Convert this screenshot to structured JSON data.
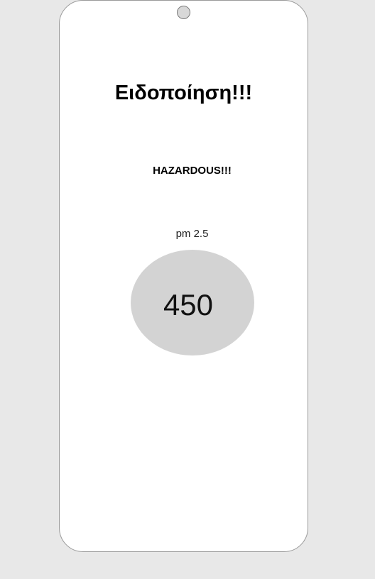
{
  "notification": {
    "title": "Ειδοποίηση!!!",
    "status": "HAZARDOUS!!!",
    "metric_label": "pm 2.5",
    "metric_value": "450"
  },
  "colors": {
    "background": "#e8e8e8",
    "phone": "#ffffff",
    "bubble": "#d3d3d3"
  }
}
